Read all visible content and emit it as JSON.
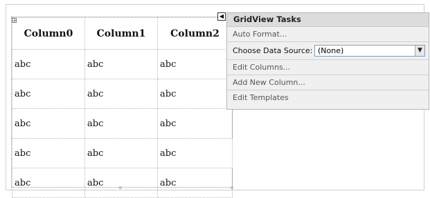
{
  "grid": {
    "columns": [
      "Column0",
      "Column1",
      "Column2"
    ],
    "rows": [
      [
        "abc",
        "abc",
        "abc"
      ],
      [
        "abc",
        "abc",
        "abc"
      ],
      [
        "abc",
        "abc",
        "abc"
      ],
      [
        "abc",
        "abc",
        "abc"
      ],
      [
        "abc",
        "abc",
        "abc"
      ]
    ]
  },
  "tasks": {
    "title": "GridView Tasks",
    "auto_format": "Auto Format...",
    "choose_label": "Choose Data Source:",
    "choose_value": "(None)",
    "edit_columns": "Edit Columns...",
    "add_column": "Add New Column...",
    "edit_templates": "Edit Templates",
    "collapse_icon": "triangle-left-icon",
    "dropdown_icon": "chevron-down-icon"
  }
}
